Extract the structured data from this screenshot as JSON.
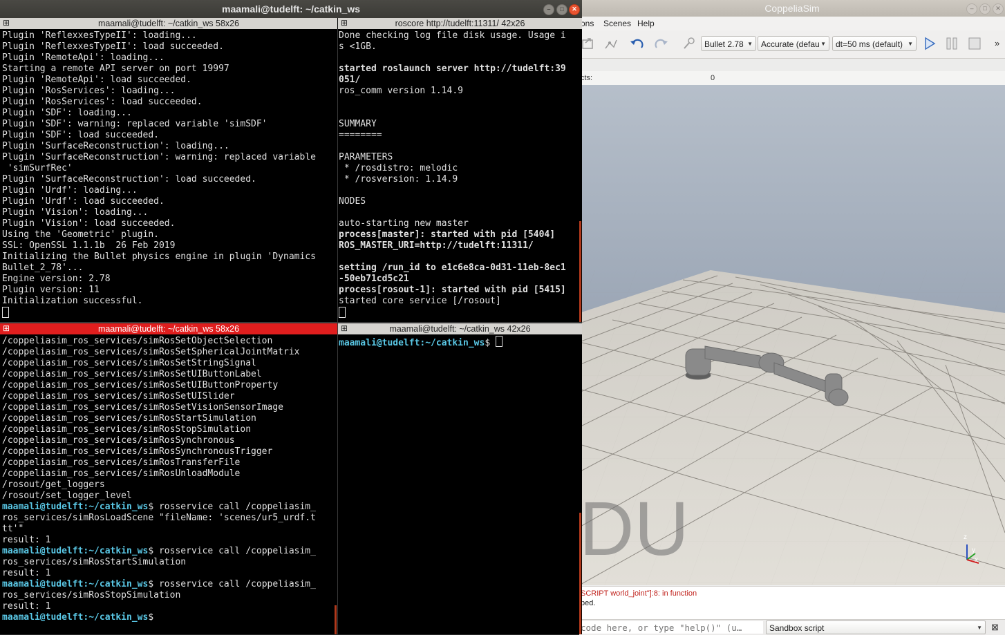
{
  "terminal": {
    "window_title": "maamali@tudelft: ~/catkin_ws",
    "panes": [
      {
        "title": "maamali@tudelft: ~/catkin_ws 58x26",
        "lines": [
          "Plugin 'ReflexxesTypeII': loading...",
          "Plugin 'ReflexxesTypeII': load succeeded.",
          "Plugin 'RemoteApi': loading...",
          "Starting a remote API server on port 19997",
          "Plugin 'RemoteApi': load succeeded.",
          "Plugin 'RosServices': loading...",
          "Plugin 'RosServices': load succeeded.",
          "Plugin 'SDF': loading...",
          "Plugin 'SDF': warning: replaced variable 'simSDF'",
          "Plugin 'SDF': load succeeded.",
          "Plugin 'SurfaceReconstruction': loading...",
          "Plugin 'SurfaceReconstruction': warning: replaced variable",
          " 'simSurfRec'",
          "Plugin 'SurfaceReconstruction': load succeeded.",
          "Plugin 'Urdf': loading...",
          "Plugin 'Urdf': load succeeded.",
          "Plugin 'Vision': loading...",
          "Plugin 'Vision': load succeeded.",
          "Using the 'Geometric' plugin.",
          "SSL: OpenSSL 1.1.1b  26 Feb 2019",
          "Initializing the Bullet physics engine in plugin 'Dynamics",
          "Bullet_2_78'...",
          "Engine version: 2.78",
          "Plugin version: 11",
          "Initialization successful."
        ]
      },
      {
        "title": "roscore http://tudelft:11311/ 42x26",
        "lines": [
          {
            "t": "Done checking log file disk usage. Usage i",
            "b": false
          },
          {
            "t": "s <1GB.",
            "b": false
          },
          {
            "t": "",
            "b": false
          },
          {
            "t": "started roslaunch server http://tudelft:39",
            "b": true
          },
          {
            "t": "051/",
            "b": true
          },
          {
            "t": "ros_comm version 1.14.9",
            "b": false
          },
          {
            "t": "",
            "b": false
          },
          {
            "t": "",
            "b": false
          },
          {
            "t": "SUMMARY",
            "b": false
          },
          {
            "t": "========",
            "b": false
          },
          {
            "t": "",
            "b": false
          },
          {
            "t": "PARAMETERS",
            "b": false
          },
          {
            "t": " * /rosdistro: melodic",
            "b": false
          },
          {
            "t": " * /rosversion: 1.14.9",
            "b": false
          },
          {
            "t": "",
            "b": false
          },
          {
            "t": "NODES",
            "b": false
          },
          {
            "t": "",
            "b": false
          },
          {
            "t": "auto-starting new master",
            "b": false
          },
          {
            "t": "process[master]: started with pid [5404]",
            "b": true
          },
          {
            "t": "ROS_MASTER_URI=http://tudelft:11311/",
            "b": true
          },
          {
            "t": "",
            "b": false
          },
          {
            "t": "setting /run_id to e1c6e8ca-0d31-11eb-8ec1",
            "b": true
          },
          {
            "t": "-50eb71cd5c21",
            "b": true
          },
          {
            "t": "process[rosout-1]: started with pid [5415]",
            "b": true
          },
          {
            "t": "started core service [/rosout]",
            "b": false
          }
        ]
      },
      {
        "title": "maamali@tudelft: ~/catkin_ws 58x26",
        "lines": [
          {
            "p": "",
            "t": "/coppeliasim_ros_services/simRosSetObjectSelection"
          },
          {
            "p": "",
            "t": "/coppeliasim_ros_services/simRosSetSphericalJointMatrix"
          },
          {
            "p": "",
            "t": "/coppeliasim_ros_services/simRosSetStringSignal"
          },
          {
            "p": "",
            "t": "/coppeliasim_ros_services/simRosSetUIButtonLabel"
          },
          {
            "p": "",
            "t": "/coppeliasim_ros_services/simRosSetUIButtonProperty"
          },
          {
            "p": "",
            "t": "/coppeliasim_ros_services/simRosSetUISlider"
          },
          {
            "p": "",
            "t": "/coppeliasim_ros_services/simRosSetVisionSensorImage"
          },
          {
            "p": "",
            "t": "/coppeliasim_ros_services/simRosStartSimulation"
          },
          {
            "p": "",
            "t": "/coppeliasim_ros_services/simRosStopSimulation"
          },
          {
            "p": "",
            "t": "/coppeliasim_ros_services/simRosSynchronous"
          },
          {
            "p": "",
            "t": "/coppeliasim_ros_services/simRosSynchronousTrigger"
          },
          {
            "p": "",
            "t": "/coppeliasim_ros_services/simRosTransferFile"
          },
          {
            "p": "",
            "t": "/coppeliasim_ros_services/simRosUnloadModule"
          },
          {
            "p": "",
            "t": "/rosout/get_loggers"
          },
          {
            "p": "",
            "t": "/rosout/set_logger_level"
          },
          {
            "p": "maamali@tudelft:~/catkin_ws",
            "t": "$ rosservice call /coppeliasim_"
          },
          {
            "p": "",
            "t": "ros_services/simRosLoadScene \"fileName: 'scenes/ur5_urdf.t"
          },
          {
            "p": "",
            "t": "tt'\""
          },
          {
            "p": "",
            "t": "result: 1"
          },
          {
            "p": "maamali@tudelft:~/catkin_ws",
            "t": "$ rosservice call /coppeliasim_"
          },
          {
            "p": "",
            "t": "ros_services/simRosStartSimulation"
          },
          {
            "p": "",
            "t": "result: 1"
          },
          {
            "p": "maamali@tudelft:~/catkin_ws",
            "t": "$ rosservice call /coppeliasim_"
          },
          {
            "p": "",
            "t": "ros_services/simRosStopSimulation"
          },
          {
            "p": "",
            "t": "result: 1"
          },
          {
            "p": "maamali@tudelft:~/catkin_ws",
            "t": "$"
          }
        ]
      },
      {
        "title": "maamali@tudelft: ~/catkin_ws 42x26",
        "prompt": "maamali@tudelft:~/catkin_ws",
        "prompt_suffix": "$ "
      }
    ]
  },
  "coppelia": {
    "title": "CoppeliaSim",
    "menu": [
      "ons",
      "Scenes",
      "Help"
    ],
    "engine": "Bullet 2.78",
    "accuracy": "Accurate (defau",
    "timestep": "dt=50 ms (default)",
    "hier_label": "cts:",
    "hier_value": "0",
    "overlay_text": "DU",
    "console_lines": [
      "SCRIPT world_joint\"]:8: in function",
      "ped."
    ],
    "console_color": "#c0201a",
    "command_placeholder": "code here, or type \"help()\" (u…",
    "script_select": "Sandbox script",
    "axes": [
      "z",
      "y",
      "x"
    ]
  }
}
